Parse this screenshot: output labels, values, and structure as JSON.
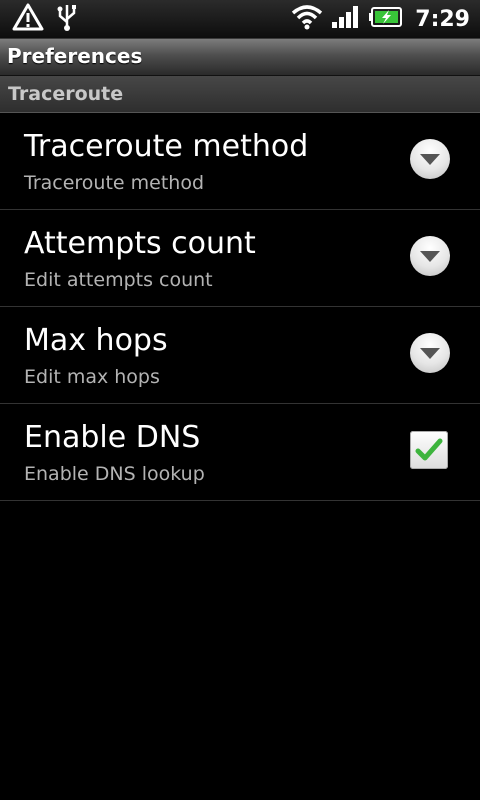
{
  "status_bar": {
    "time": "7:29",
    "icons": [
      "alert-icon",
      "usb-icon",
      "wifi-icon",
      "signal-icon",
      "battery-charging-icon"
    ]
  },
  "title_bar": {
    "title": "Preferences"
  },
  "category": {
    "label": "Traceroute"
  },
  "preferences": [
    {
      "title": "Traceroute method",
      "summary": "Traceroute method",
      "widget": "dropdown"
    },
    {
      "title": "Attempts count",
      "summary": "Edit attempts count",
      "widget": "dropdown"
    },
    {
      "title": "Max hops",
      "summary": "Edit max hops",
      "widget": "dropdown"
    },
    {
      "title": "Enable DNS",
      "summary": "Enable DNS lookup",
      "widget": "checkbox",
      "checked": true
    }
  ],
  "colors": {
    "background": "#000000",
    "check_green": "#3db43d",
    "summary_text": "#b3b3b3"
  }
}
